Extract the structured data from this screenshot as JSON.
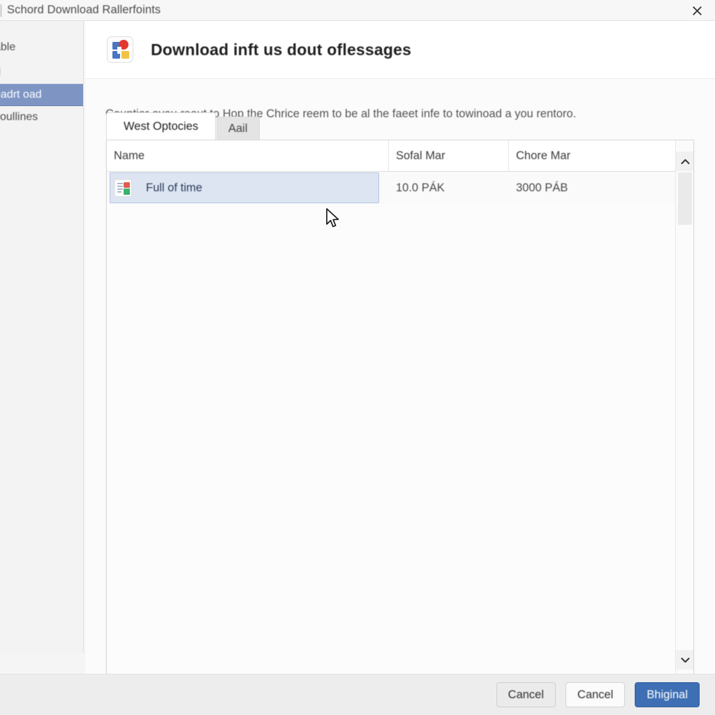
{
  "window": {
    "title": "Schord Download Rallerfoints",
    "close_icon": "close-icon"
  },
  "sidebar": {
    "items": [
      {
        "label": "able",
        "selected": false
      },
      {
        "label": "d",
        "selected": false
      },
      {
        "label": "eadrt oad",
        "selected": true
      },
      {
        "label": "voullines",
        "selected": false
      }
    ]
  },
  "header": {
    "icon": "app-grid-icon",
    "title": "Download inft us dout ᴏflessages"
  },
  "description": "Couptier oyou raout to Hop the Chrice reem to be al the faeet infe to towinoad a you rentoro.",
  "tabs": [
    {
      "label": "West Optocies",
      "active": true
    },
    {
      "label": "Aail",
      "active": false
    }
  ],
  "table": {
    "columns": [
      "Name",
      "Sofal Mar",
      "Chore Mar"
    ],
    "rows": [
      {
        "icon": "spreadsheet-icon",
        "name": "Full of time",
        "sofal_mar": "10.0 PÁK",
        "chore_mar": "3000 PÁB",
        "selected": true
      }
    ],
    "scrollbar": {
      "up_icon": "chevron-up-icon",
      "down_icon": "chevron-down-icon"
    }
  },
  "footer": {
    "buttons": [
      {
        "label": "Cancel",
        "style": "secondary"
      },
      {
        "label": "Cancel",
        "style": "secondary-light"
      },
      {
        "label": "Bhiginal",
        "style": "primary"
      }
    ]
  },
  "colors": {
    "accent": "#3e6fb4",
    "sidebar_selected": "#7e95c4",
    "row_selected": "#dde5f2"
  }
}
